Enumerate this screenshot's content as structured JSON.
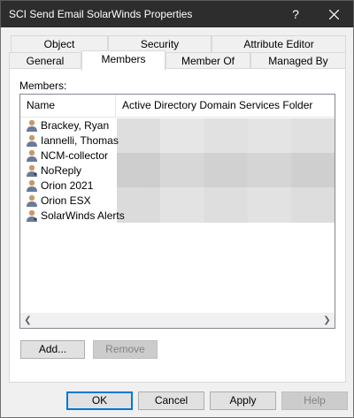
{
  "window": {
    "title": "SCI Send Email SolarWinds Properties",
    "help_label": "?",
    "close_label": "✕"
  },
  "tabs": {
    "row1": [
      {
        "label": "Object"
      },
      {
        "label": "Security"
      },
      {
        "label": "Attribute Editor"
      }
    ],
    "row2": [
      {
        "label": "General"
      },
      {
        "label": "Members"
      },
      {
        "label": "Member Of"
      },
      {
        "label": "Managed By"
      }
    ],
    "active": "Members"
  },
  "members": {
    "label": "Members:",
    "columns": [
      "Name",
      "Active Directory Domain Services Folder"
    ],
    "rows": [
      {
        "name": "Brackey, Ryan",
        "icon": "user-icon"
      },
      {
        "name": "Iannelli, Thomas",
        "icon": "user-icon"
      },
      {
        "name": "NCM-collector",
        "icon": "user-icon"
      },
      {
        "name": "NoReply",
        "icon": "user-icon"
      },
      {
        "name": "Orion 2021",
        "icon": "user-icon"
      },
      {
        "name": "Orion ESX",
        "icon": "user-icon"
      },
      {
        "name": "SolarWinds Alerts",
        "icon": "user-icon"
      }
    ]
  },
  "actions": {
    "add": "Add...",
    "remove": "Remove"
  },
  "footer": {
    "ok": "OK",
    "cancel": "Cancel",
    "apply": "Apply",
    "help": "Help"
  }
}
